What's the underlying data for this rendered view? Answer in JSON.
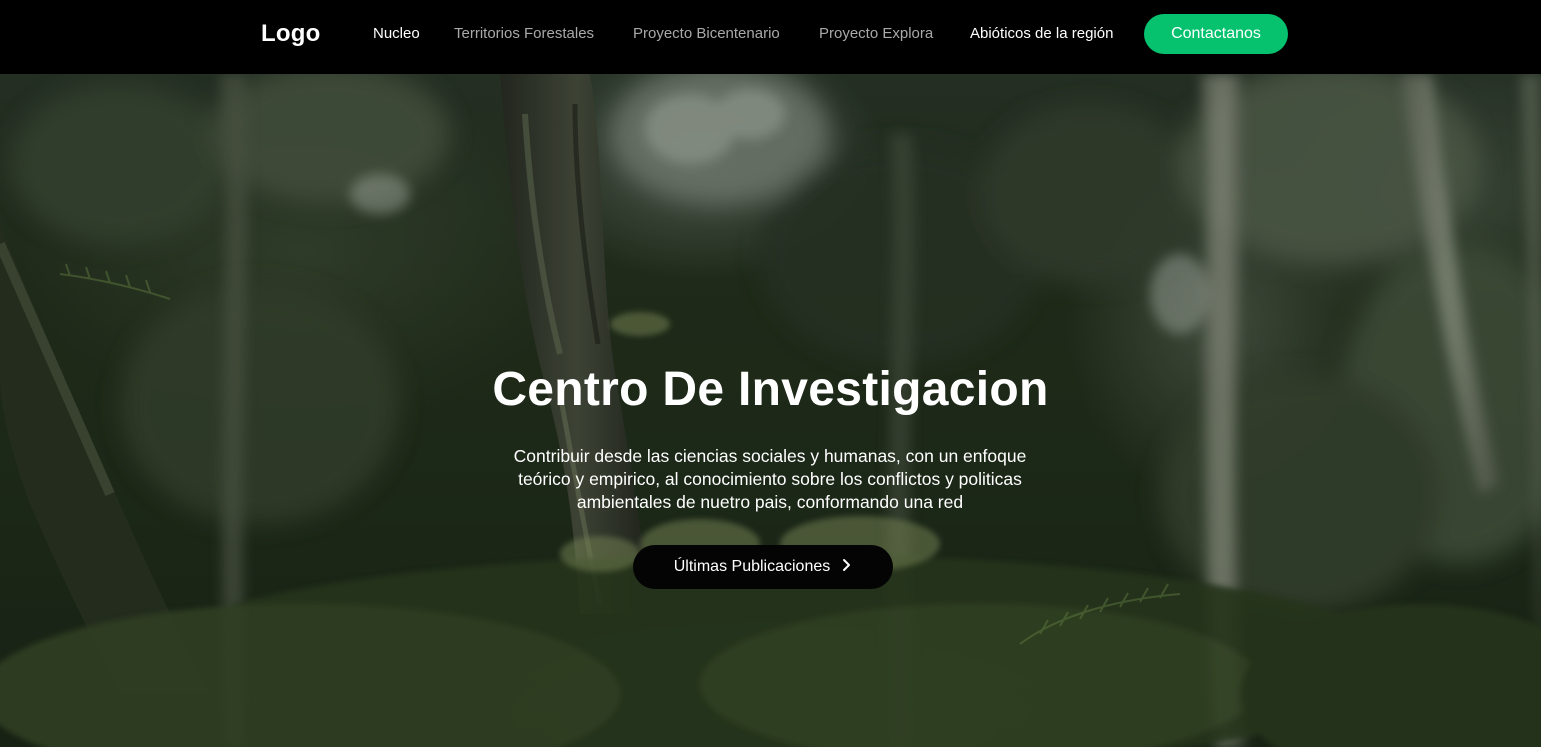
{
  "navbar": {
    "logo": "Logo",
    "links": [
      {
        "label": "Nucleo",
        "active": true
      },
      {
        "label": "Territorios Forestales",
        "active": false
      },
      {
        "label": "Proyecto Bicentenario",
        "active": false
      },
      {
        "label": "Proyecto Explora",
        "active": false
      },
      {
        "label": "Abióticos de la región",
        "active": true
      }
    ],
    "contact_label": "Contactanos"
  },
  "hero": {
    "title": "Centro De Investigacion",
    "description_lines": [
      "Contribuir desde las ciencias sociales y humanas, con un enfoque",
      "teórico y empirico, al conocimiento sobre los conflictos y politicas",
      "ambientales de nuetro pais, conformando una red"
    ],
    "button_label": "Últimas Publicaciones",
    "button_icon": "chevron-right-icon",
    "background": "forest-photo"
  },
  "colors": {
    "navbar_bg": "#000000",
    "accent_green": "#06c26f",
    "nav_inactive": "#a9a9a9",
    "text_white": "#ffffff"
  }
}
